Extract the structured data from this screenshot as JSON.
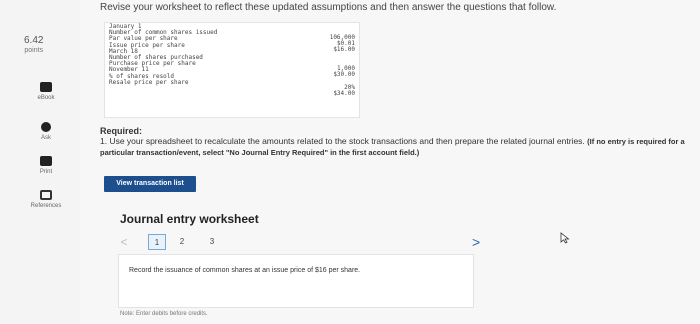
{
  "instruction": "Revise your worksheet to reflect these updated assumptions and then answer the questions that follow.",
  "sidebar": {
    "points_value": "6.42",
    "points_label": "points",
    "items": [
      {
        "label": "eBook",
        "icon": "ebook-icon"
      },
      {
        "label": "Ask",
        "icon": "ask-icon"
      },
      {
        "label": "Print",
        "icon": "print-icon"
      },
      {
        "label": "References",
        "icon": "references-icon"
      }
    ]
  },
  "worksheet": {
    "labels": [
      "January 1",
      "Number of common shares issued",
      "Par value per share",
      "Issue price per share",
      "March 18",
      "Number of shares purchased",
      "Purchase price per share",
      "November 11",
      "% of shares resold",
      "Resale price per share"
    ],
    "values": [
      "106,000",
      "$0.01",
      "$16.00",
      "",
      "",
      "1,000",
      "$30.00",
      "",
      "20%",
      "$34.00"
    ]
  },
  "required": {
    "heading": "Required:",
    "text": "1. Use your spreadsheet to recalculate the amounts related to the stock transactions and then prepare the related journal entries.",
    "bold_text": "(If no entry is required for a particular transaction/event, select \"No Journal Entry Required\" in the first account field.)"
  },
  "view_button": "View transaction list",
  "journal": {
    "title": "Journal entry worksheet",
    "prev_arrow": "<",
    "pages": [
      "1",
      "2",
      "3"
    ],
    "next_arrow": ">",
    "description": "Record the issuance of common shares at an issue price of $16 per share.",
    "note": "Note: Enter debits before credits."
  }
}
